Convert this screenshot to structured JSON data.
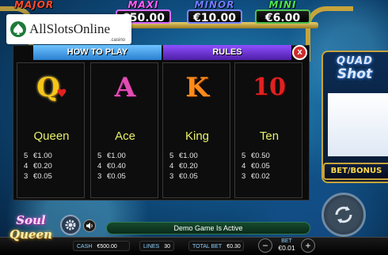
{
  "jackpots": {
    "major": {
      "name": "MAJOR",
      "value": ""
    },
    "maxi": {
      "name": "MAXI",
      "value": "€50.00"
    },
    "minor": {
      "name": "MINOR",
      "value": "€10.00"
    },
    "mini": {
      "name": "MINI",
      "value": "€6.00"
    }
  },
  "watermark": {
    "text": "AllSlotsOnline",
    "sub": ".casino"
  },
  "side_panel": {
    "logo_line1": "QUAD",
    "logo_line2": "Shot",
    "bet_bonus": "BET/BONUS"
  },
  "paytable": {
    "tabs": [
      "HOW TO PLAY",
      "RULES"
    ],
    "close": "x",
    "cards": [
      {
        "symbol": "Q",
        "name": "Queen",
        "pays": [
          {
            "n": "5",
            "v": "€1.00"
          },
          {
            "n": "4",
            "v": "€0.20"
          },
          {
            "n": "3",
            "v": "€0.05"
          }
        ]
      },
      {
        "symbol": "A",
        "name": "Ace",
        "pays": [
          {
            "n": "5",
            "v": "€1.00"
          },
          {
            "n": "4",
            "v": "€0.40"
          },
          {
            "n": "3",
            "v": "€0.05"
          }
        ]
      },
      {
        "symbol": "K",
        "name": "King",
        "pays": [
          {
            "n": "5",
            "v": "€1.00"
          },
          {
            "n": "4",
            "v": "€0.20"
          },
          {
            "n": "3",
            "v": "€0.05"
          }
        ]
      },
      {
        "symbol": "10",
        "name": "Ten",
        "pays": [
          {
            "n": "5",
            "v": "€0.50"
          },
          {
            "n": "4",
            "v": "€0.05"
          },
          {
            "n": "3",
            "v": "€0.02"
          }
        ]
      }
    ]
  },
  "bottom": {
    "message": "Demo Game Is Active",
    "cash_label": "CASH",
    "cash_value": "€500.00",
    "lines_label": "LINES",
    "lines_value": "30",
    "total_bet_label": "TOTAL BET",
    "total_bet_value": "€0.30",
    "bet_label": "BET",
    "bet_value": "€0.01",
    "minus": "−",
    "plus": "+"
  },
  "game_logo": {
    "line1": "Soul",
    "line2": "Queen"
  },
  "icons": [
    "gear-icon",
    "speaker-icon",
    "spin-arrows-icon",
    "spade-icon"
  ]
}
